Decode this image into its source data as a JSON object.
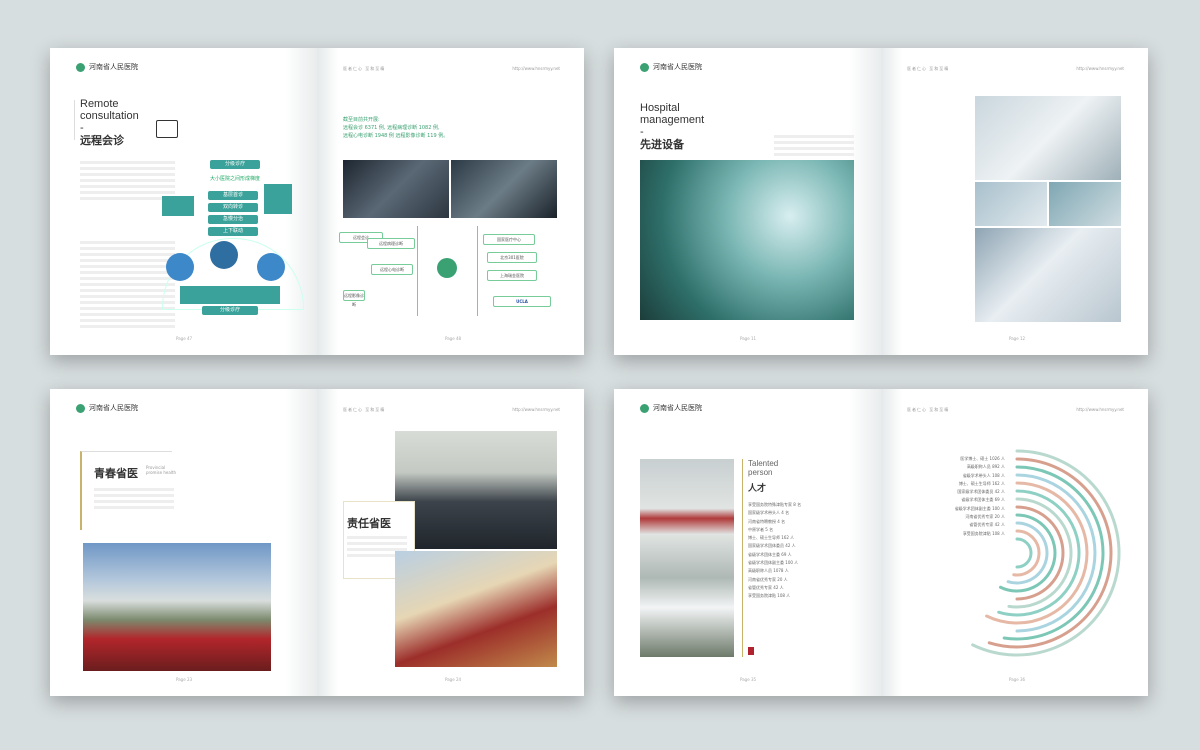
{
  "brand": {
    "logo_text": "河南省人民医院"
  },
  "header": {
    "tag": "医者仁心  至和至精",
    "url": "http://www.hnsrmyy.net"
  },
  "spread1": {
    "left": {
      "en": "Remote\nconsultation",
      "dash": "-",
      "cn": "远程会诊",
      "page": "Page 47",
      "diagram": {
        "top": "分级诊疗",
        "middle": "大小医院之间形成梯度",
        "steps": [
          "基层首诊",
          "双向转诊",
          "急慢分治",
          "上下联动"
        ],
        "bottom": "分级诊疗"
      }
    },
    "right": {
      "page": "Page 48",
      "stats": [
        "截至目前共开展:",
        "远程会诊 6371 例, 远程病理诊断 1082 例,",
        "远程心电诊断 1948 例 远程影像诊断 119 例。"
      ],
      "nodes_left": [
        "远程会诊",
        "远程病理诊断",
        "远程心电诊断",
        "远程影像诊断"
      ],
      "nodes_right": [
        "国家医疗中心",
        "北京301医院",
        "上海瑞金医院"
      ],
      "ucla": "UCLA"
    }
  },
  "spread2": {
    "left": {
      "en": "Hospital\nmanagement",
      "dash": "-",
      "cn": "先进设备",
      "page": "Page 11"
    },
    "right": {
      "page": "Page 12"
    }
  },
  "spread3": {
    "left": {
      "cn": "青春省医",
      "en_small": "Provincial\npromise health",
      "page": "Page 23"
    },
    "right": {
      "cn": "责任省医",
      "page": "Page 24"
    }
  },
  "spread4": {
    "left": {
      "en": "Talented\nperson",
      "cn": "人才",
      "page": "Page 35",
      "list": [
        "享受国务院特殊津贴专家 8 名",
        "国家级学术带头人 4 名",
        "河南省特聘教授 4 名",
        "中原学者 5 名",
        "博士、硕士生导师 162 人",
        "国家级学术团体委员 42 人",
        "省级学术团体主委 69 人",
        "省级学术团体副主委 100 人",
        "高级职称人员 1078 人",
        "河南省优秀专家 20 人",
        "省管优秀专家 42 人",
        "享受国务院津贴 108 人"
      ]
    },
    "right": {
      "page": "Page 36",
      "list": [
        "医学博士、硕士 1026 人",
        "高级职称人员 892 人",
        "省级学术带头人 108 人",
        "博士、硕士生导师 162 人",
        "国家级学术团体委员 42 人",
        "省级学术团体主委 69 人",
        "省级学术团体副主委 100 人",
        "河南省优秀专家 20 人",
        "省管优秀专家 42 人",
        "享受国务院津贴 108 人"
      ],
      "ring_colors": [
        "#8fd0c4",
        "#e5b9a6",
        "#a9d4e0",
        "#7cc7b6",
        "#d7a08e",
        "#b9d9cf"
      ]
    }
  }
}
